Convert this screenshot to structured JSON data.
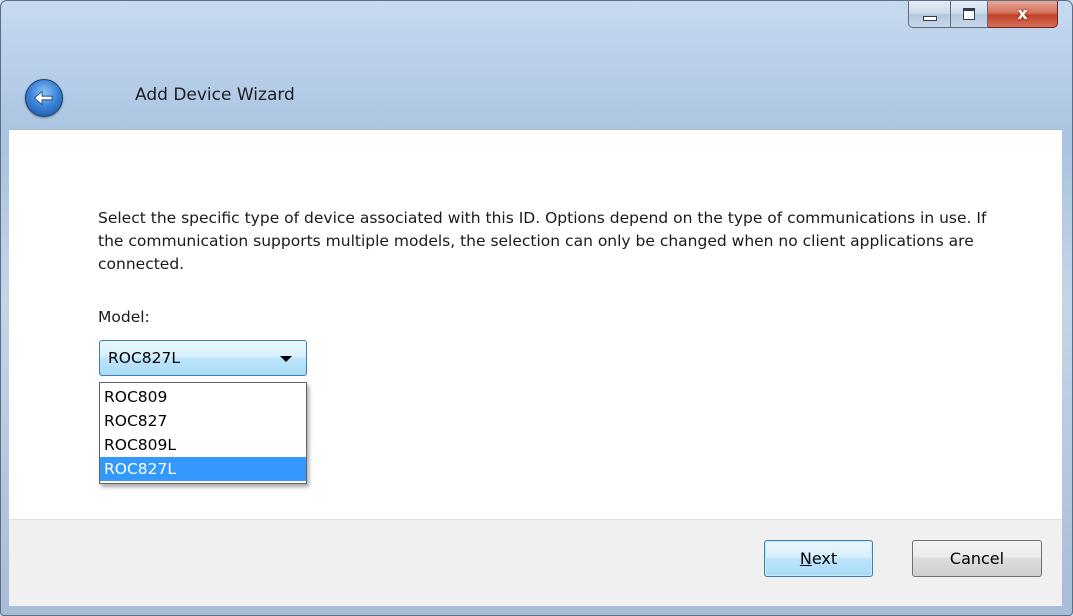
{
  "window": {
    "title": "Add Device Wizard",
    "caption_buttons": [
      {
        "name": "minimize",
        "icon": "minimize-icon"
      },
      {
        "name": "maximize",
        "icon": "maximize-icon"
      },
      {
        "name": "close",
        "icon": "close-icon",
        "glyph": "x"
      }
    ],
    "back_icon": "back-arrow-icon"
  },
  "content": {
    "description": "Select the specific type of device associated with this ID. Options depend on the type of communications in use. If the communication supports multiple models, the selection can only be changed when no client applications are connected.",
    "model_label": "Model:",
    "model": {
      "selected": "ROC827L",
      "options": [
        "ROC809",
        "ROC827",
        "ROC809L",
        "ROC827L"
      ],
      "highlighted_index": 3
    }
  },
  "footer": {
    "next_mnemonic": "N",
    "next_rest": "ext",
    "cancel_label": "Cancel"
  },
  "colors": {
    "highlight": "#3399ff",
    "frame": "#b9d0ea",
    "close_button": "#c24127"
  }
}
